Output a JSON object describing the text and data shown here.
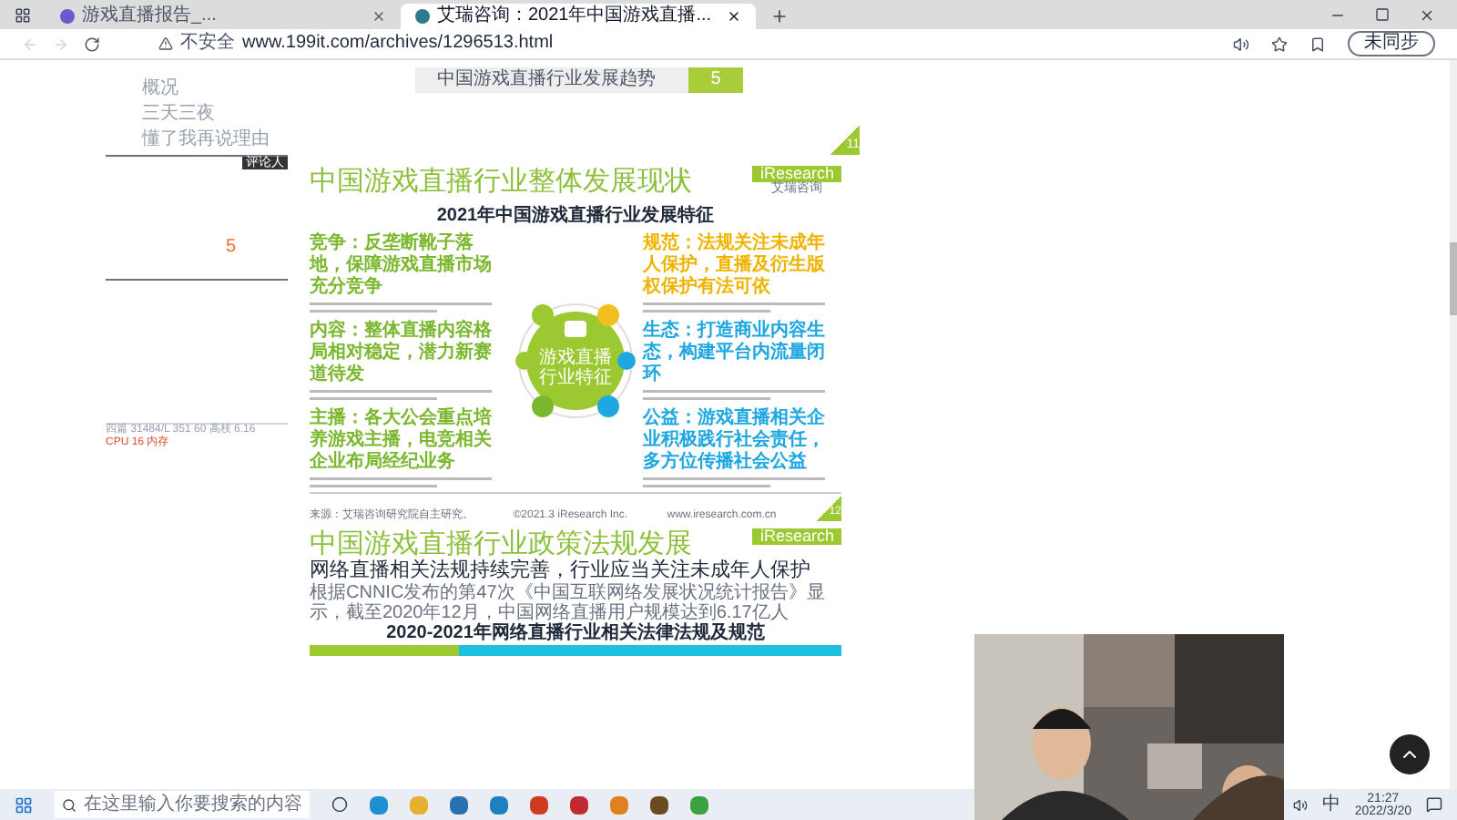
{
  "browser": {
    "tabs": [
      {
        "title": "游戏直播报告_...",
        "selected": false
      },
      {
        "title": "艾瑞咨询：2021年中国游戏直播...",
        "selected": true
      }
    ],
    "url_warning": "不安全",
    "url": "www.199it.com/archives/1296513.html",
    "sync_button": "未同步"
  },
  "side_panel": {
    "links": [
      "概况",
      "三天三夜",
      "懂了我再说理由"
    ],
    "badge": "评论人",
    "count": "5",
    "status": "四篇 31484/L 351 60 高枝 6.16",
    "cpu": "CPU 16 内存"
  },
  "doc_header": {
    "title": "中国游戏直播行业发展趋势",
    "page": "5"
  },
  "slide1": {
    "title": "中国游戏直播行业整体发展现状",
    "logo": "iResearch",
    "logo_sub": "艾瑞咨询",
    "chart_title": "2021年中国游戏直播行业发展特征",
    "center_label": "游戏直播行业特征",
    "left_features": [
      {
        "heading": "竞争：反垄断靴子落地，保障游戏直播市场充分竞争",
        "color": "#7cb82f"
      },
      {
        "heading": "内容：整体直播内容格局相对稳定，潜力新赛道待发",
        "color": "#7cb82f"
      },
      {
        "heading": "主播：各大公会重点培养游戏主播，电竞相关企业布局经纪业务",
        "color": "#7cb82f"
      }
    ],
    "right_features": [
      {
        "heading": "规范：法规关注未成年人保护，直播及衍生版权保护有法可依",
        "color": "#f0b400"
      },
      {
        "heading": "生态：打造商业内容生态，构建平台内流量闭环",
        "color": "#1ea7e0"
      },
      {
        "heading": "公益：游戏直播相关企业积极践行社会责任，多方位传播社会公益",
        "color": "#1ea7e0"
      }
    ],
    "source": "来源：艾瑞咨询研究院自主研究。",
    "copyright": "©2021.3 iResearch Inc.",
    "website": "www.iresearch.com.cn",
    "page": "12",
    "prev_page": "11"
  },
  "slide2": {
    "title": "中国游戏直播行业政策法规发展",
    "logo": "iResearch",
    "subtitle": "网络直播相关法规持续完善，行业应当关注未成年人保护",
    "paragraph": "根据CNNIC发布的第47次《中国互联网络发展状况统计报告》显示，截至2020年12月，中国网络直播用户规模达到6.17亿人",
    "table_title": "2020-2021年网络直播行业相关法律法规及规范"
  },
  "taskbar": {
    "search_placeholder": "在这里输入你要搜索的内容",
    "ime": "中",
    "time": "21:27",
    "date": "2022/3/20"
  }
}
